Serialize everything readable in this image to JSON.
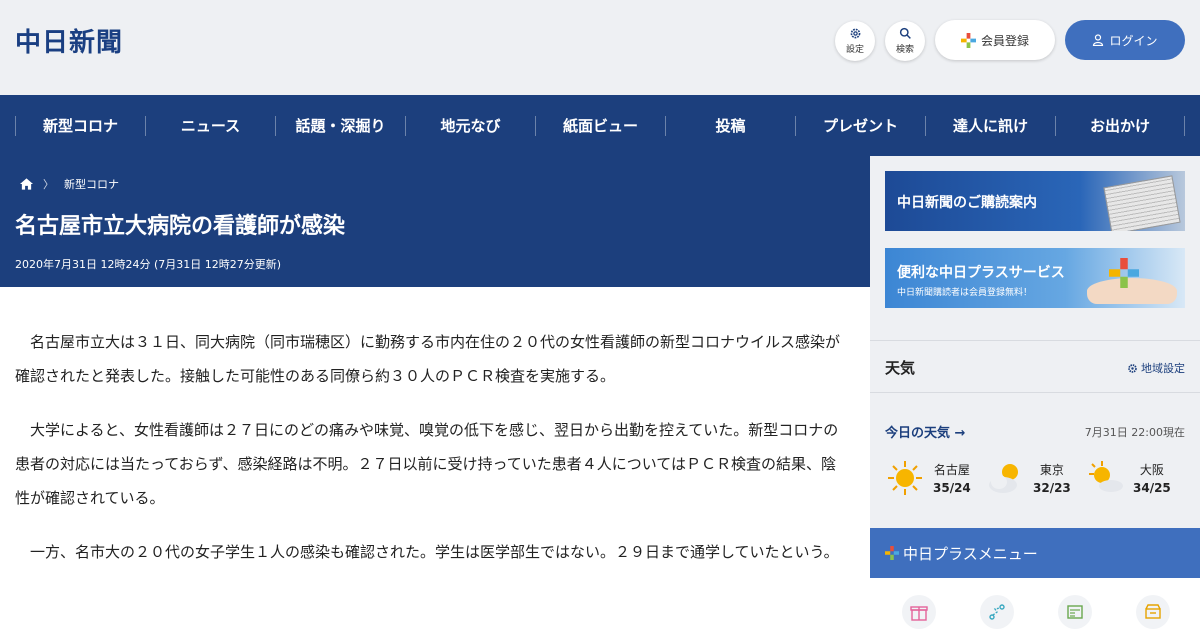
{
  "header": {
    "logo": "中日新聞",
    "settings_label": "設定",
    "search_label": "検索",
    "register_label": "会員登録",
    "login_label": "ログイン"
  },
  "nav": {
    "items": [
      "新型コロナ",
      "ニュース",
      "話題・深掘り",
      "地元なび",
      "紙面ビュー",
      "投稿",
      "プレゼント",
      "達人に訊け",
      "お出かけ"
    ]
  },
  "article": {
    "breadcrumb_category": "新型コロナ",
    "title": "名古屋市立大病院の看護師が感染",
    "date": "2020年7月31日 12時24分 (7月31日 12時27分更新)",
    "paragraphs": [
      "名古屋市立大は３１日、同大病院（同市瑞穂区）に勤務する市内在住の２０代の女性看護師の新型コロナウイルス感染が確認されたと発表した。接触した可能性のある同僚ら約３０人のＰＣＲ検査を実施する。",
      "大学によると、女性看護師は２７日にのどの痛みや味覚、嗅覚の低下を感じ、翌日から出勤を控えていた。新型コロナの患者の対応には当たっておらず、感染経路は不明。２７日以前に受け持っていた患者４人についてはＰＣＲ検査の結果、陰性が確認されている。",
      "一方、名市大の２０代の女子学生１人の感染も確認された。学生は医学部生ではない。２９日まで通学していたという。"
    ]
  },
  "sidebar": {
    "banner1": "中日新聞のご購読案内",
    "banner2_title": "便利な中日プラスサービス",
    "banner2_sub": "中日新聞購読者は会員登録無料！",
    "weather_heading": "天気",
    "region_settings": "地域設定",
    "today_weather": "今日の天気",
    "as_of": "7月31日 22:00現在",
    "cities": [
      {
        "name": "名古屋",
        "temp": "35/24",
        "icon": "sun-icon"
      },
      {
        "name": "東京",
        "temp": "32/23",
        "icon": "sun-cloud-icon"
      },
      {
        "name": "大阪",
        "temp": "34/25",
        "icon": "sun-cloud-icon"
      }
    ],
    "plus_menu": "中日プラスメニュー"
  },
  "colors": {
    "navy": "#1c3f7d",
    "accent_blue": "#3f6fbe",
    "background": "#eef0f3"
  }
}
